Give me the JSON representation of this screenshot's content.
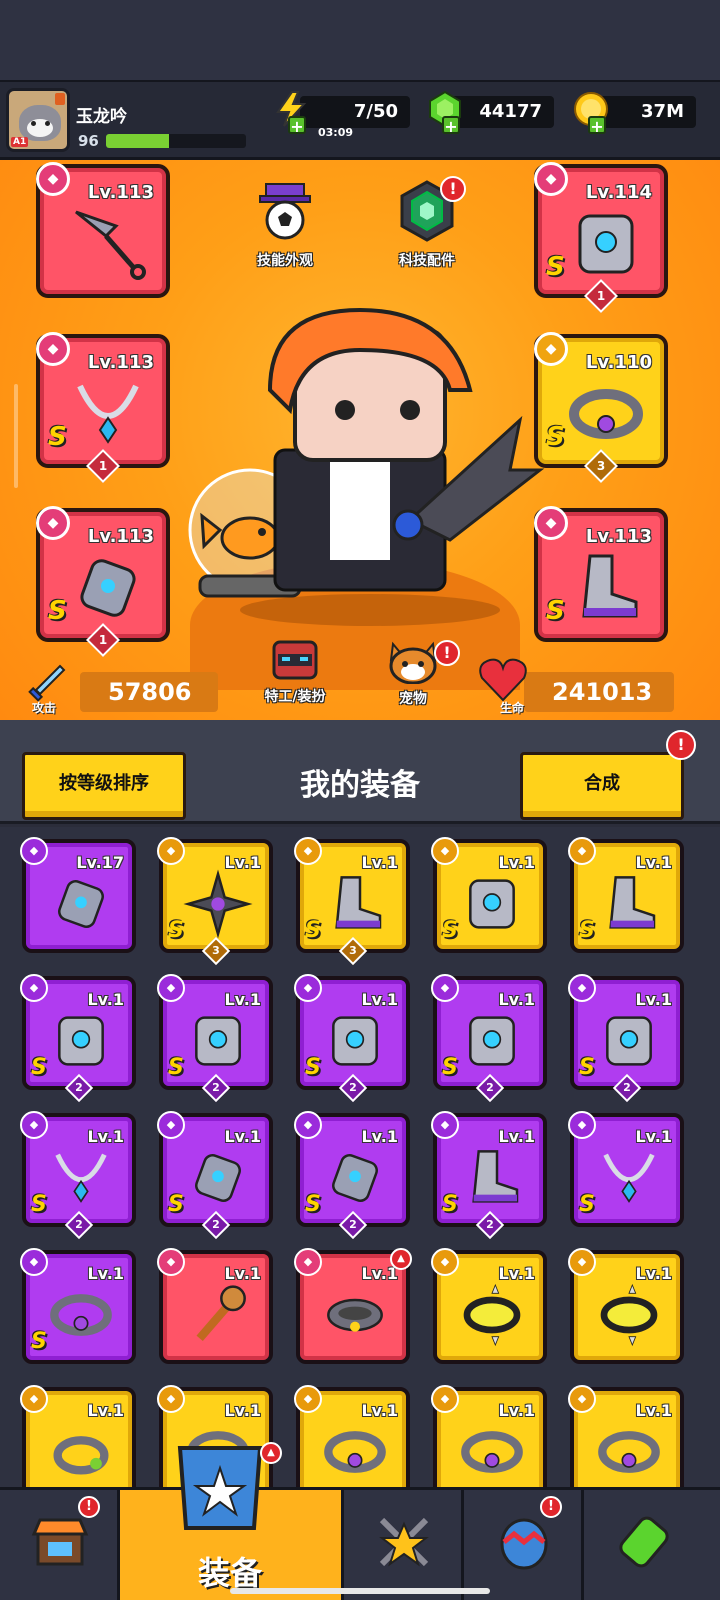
{
  "player": {
    "name": "玉龙吟",
    "level": "96",
    "xp_fraction": 0.45,
    "rank_badge": "A1"
  },
  "resources": {
    "energy": {
      "value": "7/50",
      "timer": "03:09",
      "icon": "lightning-icon"
    },
    "gems": {
      "value": "44177",
      "icon": "green-gem-icon"
    },
    "coins": {
      "value": "37M",
      "icon": "gold-coin-icon"
    }
  },
  "hero_actions": {
    "skill_skin": "技能外观",
    "tech_parts": "科技配件",
    "agent_costume": "特工/装扮",
    "pet": "宠物"
  },
  "equipped": [
    {
      "slot": "weapon",
      "level": "Lv.113",
      "rarity": "",
      "stack": "",
      "color": "red",
      "icon": "kunai-icon"
    },
    {
      "slot": "armor",
      "level": "Lv.114",
      "rarity": "S",
      "stack": "1",
      "color": "red",
      "icon": "armor-icon"
    },
    {
      "slot": "necklace",
      "level": "Lv.113",
      "rarity": "S",
      "stack": "1",
      "color": "red",
      "icon": "necklace-icon"
    },
    {
      "slot": "belt",
      "level": "Lv.110",
      "rarity": "S",
      "stack": "3",
      "color": "yellow",
      "icon": "belt-icon"
    },
    {
      "slot": "gloves",
      "level": "Lv.113",
      "rarity": "S",
      "stack": "1",
      "color": "red",
      "icon": "glove-icon"
    },
    {
      "slot": "boots",
      "level": "Lv.113",
      "rarity": "S",
      "stack": "",
      "color": "red",
      "icon": "boot-icon"
    }
  ],
  "stats": {
    "attack_label": "攻击",
    "attack": "57806",
    "hp_label": "生命",
    "hp": "241013"
  },
  "inventory_header": {
    "sort_button": "按等级排序",
    "title": "我的装备",
    "merge_button": "合成",
    "merge_alert": "!"
  },
  "inventory": [
    {
      "level": "Lv.17",
      "rarity": "",
      "stack": "",
      "color": "purple",
      "icon": "glove-icon"
    },
    {
      "level": "Lv.1",
      "rarity": "S",
      "stack": "3",
      "color": "yellow",
      "icon": "shuriken-icon"
    },
    {
      "level": "Lv.1",
      "rarity": "S",
      "stack": "3",
      "color": "yellow",
      "icon": "boot-icon"
    },
    {
      "level": "Lv.1",
      "rarity": "S",
      "stack": "",
      "color": "yellow",
      "icon": "armor-icon"
    },
    {
      "level": "Lv.1",
      "rarity": "S",
      "stack": "",
      "color": "yellow",
      "icon": "boot-icon"
    },
    {
      "level": "Lv.1",
      "rarity": "S",
      "stack": "2",
      "color": "purple",
      "icon": "armor-icon"
    },
    {
      "level": "Lv.1",
      "rarity": "S",
      "stack": "2",
      "color": "purple",
      "icon": "armor-icon"
    },
    {
      "level": "Lv.1",
      "rarity": "S",
      "stack": "2",
      "color": "purple",
      "icon": "armor-icon"
    },
    {
      "level": "Lv.1",
      "rarity": "S",
      "stack": "2",
      "color": "purple",
      "icon": "armor-icon"
    },
    {
      "level": "Lv.1",
      "rarity": "S",
      "stack": "2",
      "color": "purple",
      "icon": "armor-icon"
    },
    {
      "level": "Lv.1",
      "rarity": "S",
      "stack": "2",
      "color": "purple",
      "icon": "necklace-icon"
    },
    {
      "level": "Lv.1",
      "rarity": "S",
      "stack": "2",
      "color": "purple",
      "icon": "glove-icon"
    },
    {
      "level": "Lv.1",
      "rarity": "S",
      "stack": "2",
      "color": "purple",
      "icon": "glove-icon"
    },
    {
      "level": "Lv.1",
      "rarity": "S",
      "stack": "2",
      "color": "purple",
      "icon": "boot-icon"
    },
    {
      "level": "Lv.1",
      "rarity": "S",
      "stack": "",
      "color": "purple",
      "icon": "necklace-icon"
    },
    {
      "level": "Lv.1",
      "rarity": "S",
      "stack": "",
      "color": "purple",
      "icon": "belt-icon"
    },
    {
      "level": "Lv.1",
      "rarity": "",
      "stack": "",
      "color": "red",
      "icon": "torch-icon"
    },
    {
      "level": "Lv.1",
      "rarity": "",
      "stack": "",
      "color": "red",
      "icon": "collar-icon"
    },
    {
      "level": "Lv.1",
      "rarity": "",
      "stack": "",
      "color": "yellow",
      "icon": "spiked-collar-icon"
    },
    {
      "level": "Lv.1",
      "rarity": "",
      "stack": "",
      "color": "yellow",
      "icon": "spiked-collar-icon"
    },
    {
      "level": "Lv.1",
      "rarity": "",
      "stack": "",
      "color": "yellow",
      "icon": "ring-icon"
    },
    {
      "level": "Lv.1",
      "rarity": "",
      "stack": "",
      "color": "yellow",
      "icon": "belt-icon"
    },
    {
      "level": "Lv.1",
      "rarity": "",
      "stack": "",
      "color": "yellow",
      "icon": "belt-icon"
    },
    {
      "level": "Lv.1",
      "rarity": "",
      "stack": "",
      "color": "yellow",
      "icon": "belt-icon"
    },
    {
      "level": "Lv.1",
      "rarity": "",
      "stack": "",
      "color": "yellow",
      "icon": "belt-icon"
    }
  ],
  "nav": {
    "active_label": "装备",
    "items": [
      "shop-icon",
      "equipment-icon",
      "battle-icon",
      "egg-icon",
      "tech-icon"
    ]
  }
}
